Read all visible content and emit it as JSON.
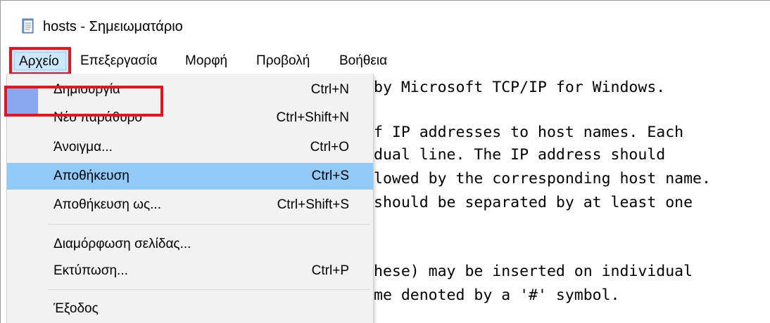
{
  "window": {
    "title": "hosts - Σημειωματάριο",
    "icon": "notepad-icon"
  },
  "menubar": {
    "file": "Αρχείο",
    "edit": "Επεξεργασία",
    "format": "Μορφή",
    "view": "Προβολή",
    "help": "Βοήθεια"
  },
  "file_menu": {
    "items": [
      {
        "label": "Δημιουργία",
        "shortcut": "Ctrl+N"
      },
      {
        "label": "Νέο παράθυρο",
        "shortcut": "Ctrl+Shift+N"
      },
      {
        "label": "Άνοιγμα...",
        "shortcut": "Ctrl+O"
      },
      {
        "label": "Αποθήκευση",
        "shortcut": "Ctrl+S"
      },
      {
        "label": "Αποθήκευση ως...",
        "shortcut": "Ctrl+Shift+S"
      },
      {
        "label": "Διαμόρφωση σελίδας...",
        "shortcut": ""
      },
      {
        "label": "Εκτύπωση...",
        "shortcut": "Ctrl+P"
      },
      {
        "label": "Έξοδος",
        "shortcut": ""
      }
    ],
    "highlighted_item": "Αποθήκευση"
  },
  "editor": {
    "visible_lines": [
      "by Microsoft TCP/IP for Windows.",
      "",
      "f IP addresses to host names. Each",
      "dual line. The IP address should",
      "lowed by the corresponding host name.",
      "should be separated by at least one",
      "",
      "",
      "hese) may be inserted on individual",
      "me denoted by a '#' symbol."
    ]
  },
  "colors": {
    "highlight": "#91c9f7",
    "annotation_red": "#e4151c",
    "menu_background": "#f2f2f2"
  }
}
